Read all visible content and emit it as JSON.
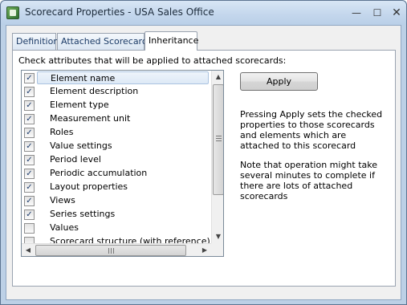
{
  "window": {
    "title": "Scorecard Properties - USA Sales Office",
    "minimize": "—",
    "maximize": "☐",
    "close": "✕"
  },
  "tabs": [
    {
      "label": "Definition",
      "active": false
    },
    {
      "label": "Attached Scorecards",
      "active": false
    },
    {
      "label": "Inheritance",
      "active": true
    }
  ],
  "inheritance": {
    "instruction": "Check attributes that will be applied to attached scorecards:",
    "apply_label": "Apply",
    "description_1": "Pressing Apply sets the checked properties to those scorecards and elements which are attached to this scorecard",
    "description_2": "Note that operation might take several minutes to complete if there are lots of attached scorecards",
    "attributes": [
      {
        "label": "Element name",
        "checked": true,
        "selected": true
      },
      {
        "label": "Element description",
        "checked": true,
        "selected": false
      },
      {
        "label": "Element type",
        "checked": true,
        "selected": false
      },
      {
        "label": "Measurement unit",
        "checked": true,
        "selected": false
      },
      {
        "label": "Roles",
        "checked": true,
        "selected": false
      },
      {
        "label": "Value settings",
        "checked": true,
        "selected": false
      },
      {
        "label": "Period level",
        "checked": true,
        "selected": false
      },
      {
        "label": "Periodic accumulation",
        "checked": true,
        "selected": false
      },
      {
        "label": "Layout properties",
        "checked": true,
        "selected": false
      },
      {
        "label": "Views",
        "checked": true,
        "selected": false
      },
      {
        "label": "Series settings",
        "checked": true,
        "selected": false
      },
      {
        "label": "Values",
        "checked": false,
        "selected": false
      },
      {
        "label": "Scorecard structure (with reference)",
        "checked": false,
        "selected": false
      }
    ]
  },
  "icons": {
    "app": "scorecard-app-icon",
    "checkmark": "✓",
    "scroll_up": "▲",
    "scroll_down": "▼",
    "scroll_left": "◀",
    "scroll_right": "▶"
  }
}
